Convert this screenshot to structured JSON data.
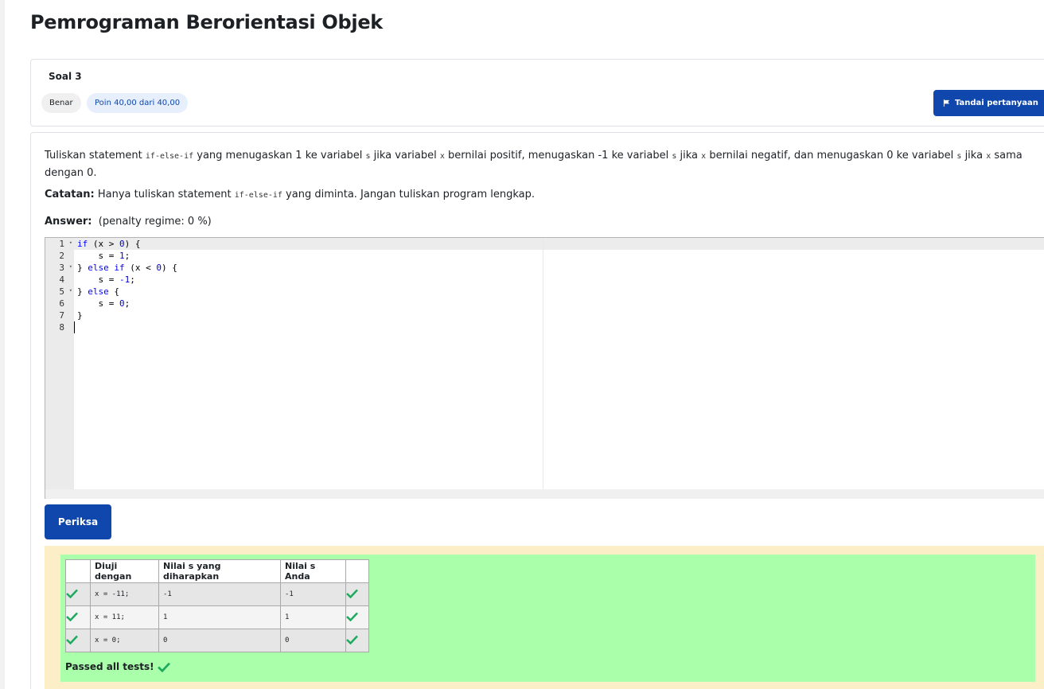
{
  "page": {
    "title": "Pemrograman Berorientasi Objek"
  },
  "question": {
    "number_label": "Soal 3",
    "state": "Benar",
    "grade": "Poin 40,00 dari 40,00",
    "flag_label": "Tandai pertanyaan",
    "text": {
      "p1": "Tuliskan statement ",
      "c1": "if-else-if",
      "p2": " yang menugaskan 1 ke variabel ",
      "c2": "s",
      "p3": " jika variabel ",
      "c3": "x",
      "p4": " bernilai positif, menugaskan -1 ke variabel ",
      "c4": "s",
      "p5": " jika ",
      "c5": "x",
      "p6": " bernilai negatif, dan menugaskan 0 ke variabel ",
      "c6": "s",
      "p7": " jika ",
      "c7": "x",
      "p8": " sama dengan 0."
    },
    "note": {
      "label": "Catatan:",
      "p1": " Hanya tuliskan statement ",
      "c1": "if-else-if",
      "p2": " yang diminta. Jangan tuliskan program lengkap."
    },
    "answer_label": "Answer:",
    "penalty": "(penalty regime: 0 %)"
  },
  "editor": {
    "lines": [
      "if (x > 0) {",
      "    s = 1;",
      "} else if (x < 0) {",
      "    s = -1;",
      "} else {",
      "    s = 0;",
      "}",
      ""
    ],
    "line_numbers": [
      "1",
      "2",
      "3",
      "4",
      "5",
      "6",
      "7",
      "8"
    ],
    "fold_marker": "▾"
  },
  "check_button": "Periksa",
  "results": {
    "headers": [
      "Diuji dengan",
      "Nilai s yang diharapkan",
      "Nilai s Anda"
    ],
    "rows": [
      {
        "test": "x = -11;",
        "expected": "-1",
        "got": "-1"
      },
      {
        "test": "x = 11;",
        "expected": "1",
        "got": "1"
      },
      {
        "test": "x = 0;",
        "expected": "0",
        "got": "0"
      }
    ],
    "summary": "Passed all tests!",
    "colors": {
      "pass": "#1daa5e",
      "background": "#aaffaa",
      "outer": "#fcefc7"
    }
  },
  "colors": {
    "primary": "#0f47ad",
    "grade_badge_bg": "#e7eefc"
  }
}
